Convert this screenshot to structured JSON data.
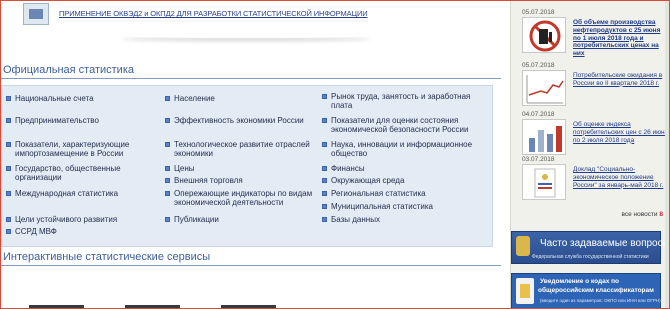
{
  "banner": {
    "link_text": "ПРИМЕНЕНИЕ ОКВЭД2 и ОКПД2 ДЛЯ РАЗРАБОТКИ СТАТИСТИЧЕСКОЙ ИНФОРМАЦИИ"
  },
  "official_stats": {
    "title": "Официальная статистика",
    "columns": [
      [
        "Национальные счета",
        "Предпринимательство",
        "Показатели, характеризующие импортозамещение в России",
        "Государство, общественные организации",
        "Международная статистика",
        "Цели устойчивого развития",
        "ССРД МВФ"
      ],
      [
        "Население",
        "Эффективность экономики России",
        "Технологическое развитие отраслей экономики",
        "Цены",
        "Внешняя торговля",
        "Опережающие индикаторы по видам экономической деятельности",
        "Публикации"
      ],
      [
        "Рынок труда, занятость и заработная плата",
        "Показатели для оценки состояния экономической безопасности России",
        "Наука, инновации и информационное общество",
        "Финансы",
        "Окружающая среда",
        "Региональная статистика",
        "Муниципальная статистика",
        "Базы данных"
      ]
    ]
  },
  "interactive": {
    "title": "Интерактивные статистические сервисы"
  },
  "news": [
    {
      "date": "05.07.2018",
      "title": "Об объеме производства нефтепродуктов с 25 июня по 1 июля 2018 года и потребительских ценах на них"
    },
    {
      "date": "05.07.2018",
      "title": "Потребительские ожидания в России во II квартале 2018 г."
    },
    {
      "date": "04.07.2018",
      "title": "Об оценке индекса потребительских цен с 26 июня по 2 июля 2018 года"
    },
    {
      "date": "03.07.2018",
      "title": "Доклад \"Социально-экономическое положение России\" за январь-май 2018 г."
    }
  ],
  "more_news": {
    "label": "все новости",
    "count": "8"
  },
  "faq_banner": {
    "title": "Часто задаваемые вопросы",
    "subtitle": "Федеральная служба государственной статистики"
  },
  "okved_banner": {
    "line1": "Уведомление о кодах по",
    "line2": "общероссийским классификаторам",
    "line3": "(введите один из параметров: ОКПО или ИНН или ОГРН)"
  },
  "colors": {
    "title_blue": "#3e5f9c",
    "panel_bg": "#e3ebf5",
    "link_blue": "#1f3a8a",
    "banner_blue": "#2e64b6"
  }
}
